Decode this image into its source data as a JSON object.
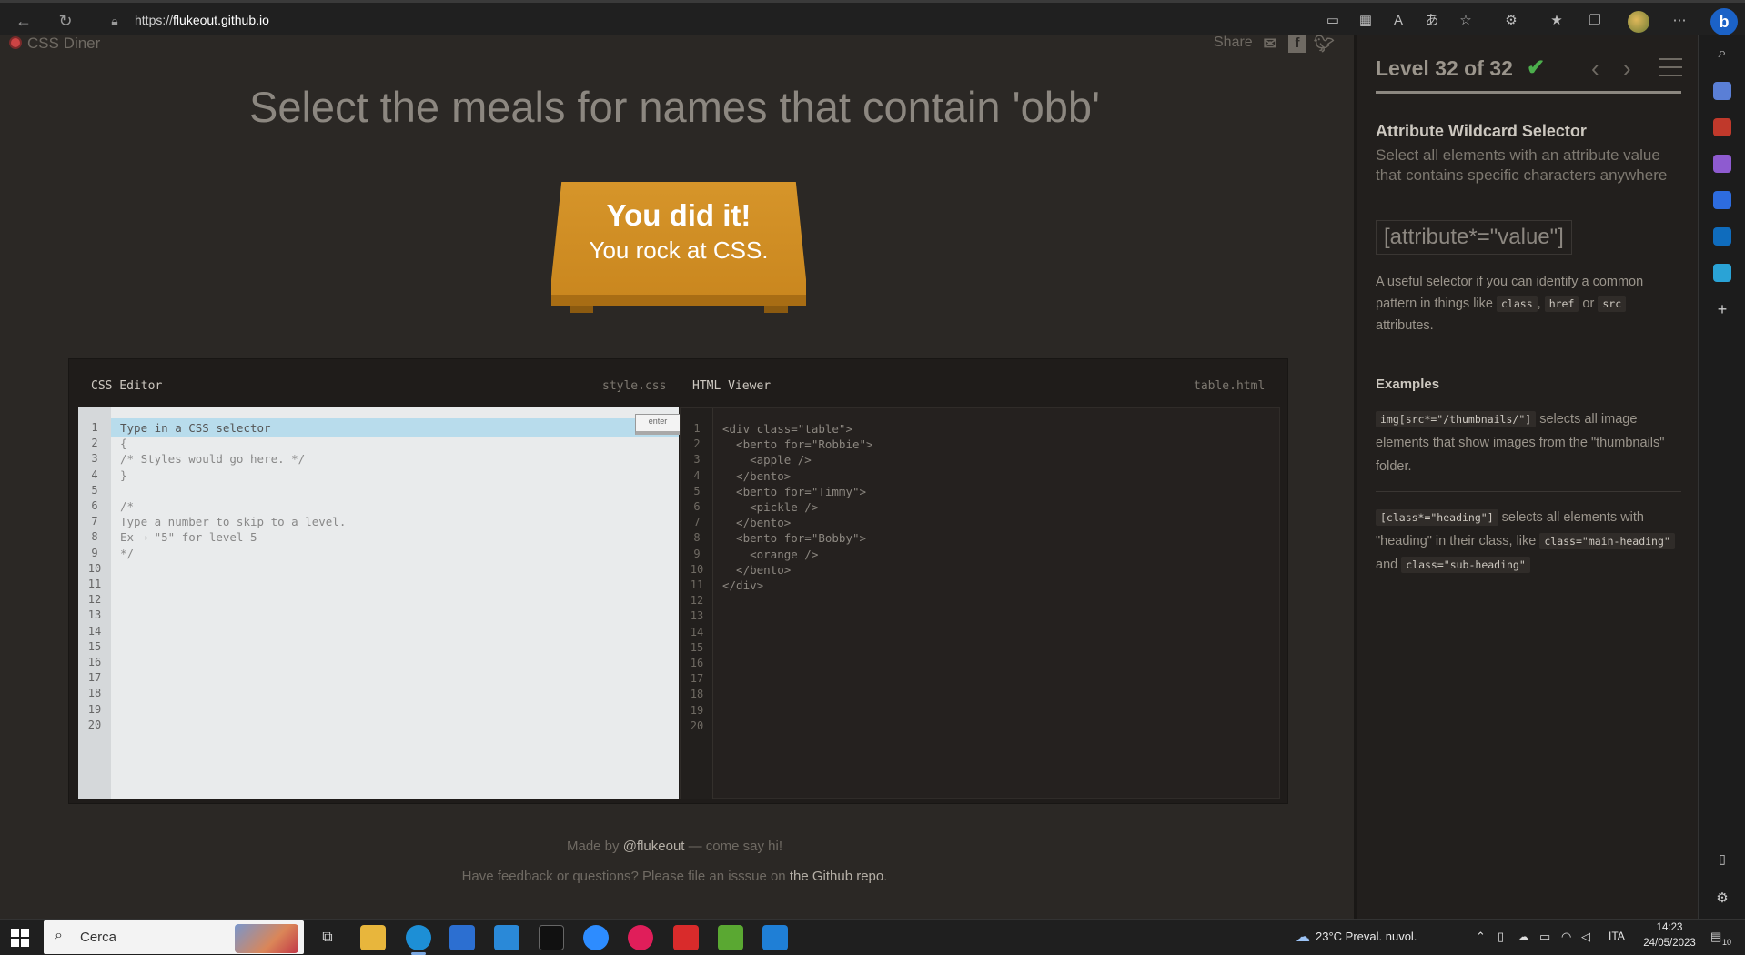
{
  "browser": {
    "url_prefix": "https://",
    "url_host": "flukeout.github.io"
  },
  "page": {
    "logo": "CSS Diner",
    "share_label": "Share",
    "instruction": "Select the meals for names that contain 'obb'",
    "win_line1": "You did it!",
    "win_line2": "You rock at CSS."
  },
  "editor": {
    "css_title": "CSS Editor",
    "css_file": "style.css",
    "html_title": "HTML Viewer",
    "html_file": "table.html",
    "input_placeholder": "Type in a CSS selector",
    "enter_label": "enter",
    "css_lines": [
      "{",
      "/* Styles would go here. */",
      "}",
      "",
      "/*",
      "Type a number to skip to a level.",
      "Ex → \"5\" for level 5",
      "*/"
    ],
    "html_lines": [
      "<div class=\"table\">",
      "  <bento for=\"Robbie\">",
      "    <apple />",
      "  </bento>",
      "  <bento for=\"Timmy\">",
      "    <pickle />",
      "  </bento>",
      "  <bento for=\"Bobby\">",
      "    <orange />",
      "  </bento>",
      "</div>"
    ],
    "line_numbers": [
      "1",
      "2",
      "3",
      "4",
      "5",
      "6",
      "7",
      "8",
      "9",
      "10",
      "11",
      "12",
      "13",
      "14",
      "15",
      "16",
      "17",
      "18",
      "19",
      "20"
    ]
  },
  "footer": {
    "line1_pre": "Made by ",
    "line1_link": "@flukeout",
    "line1_post": " — come say hi!",
    "line2_pre": "Have feedback or questions? Please file an isssue on ",
    "line2_link": "the Github repo",
    "line2_post": "."
  },
  "help": {
    "level_indicator": "Level 32 of 32",
    "level_progress": 1.0,
    "selector_name": "Attribute Wildcard Selector",
    "title": "Select all elements with an attribute value that contains specific characters anywhere",
    "syntax": "[attribute*=\"value\"]",
    "hint_pre": "A useful selector if you can identify a common pattern in things like ",
    "hint_code1": "class",
    "hint_sep1": ", ",
    "hint_code2": "href",
    "hint_sep2": " or ",
    "hint_code3": "src",
    "hint_post": " attributes.",
    "examples_title": "Examples",
    "ex1_code": "img[src*=\"/thumbnails/\"]",
    "ex1_text": " selects all image elements that show images from the \"thumbnails\" folder.",
    "ex2_code": "[class*=\"heading\"]",
    "ex2_text1": " selects all elements with \"heading\" in their class, like ",
    "ex2_code2": "class=\"main-heading\"",
    "ex2_text2": " and ",
    "ex2_code3": "class=\"sub-heading\""
  },
  "taskbar": {
    "search_placeholder": "Cerca",
    "weather": "23°C  Preval. nuvol.",
    "lang": "ITA",
    "time": "14:23",
    "date": "24/05/2023",
    "notif_count": "10"
  },
  "colors": {
    "accent_green": "#4cae4c",
    "table_orange": "#d6952a",
    "page_bg": "#2b2825"
  }
}
